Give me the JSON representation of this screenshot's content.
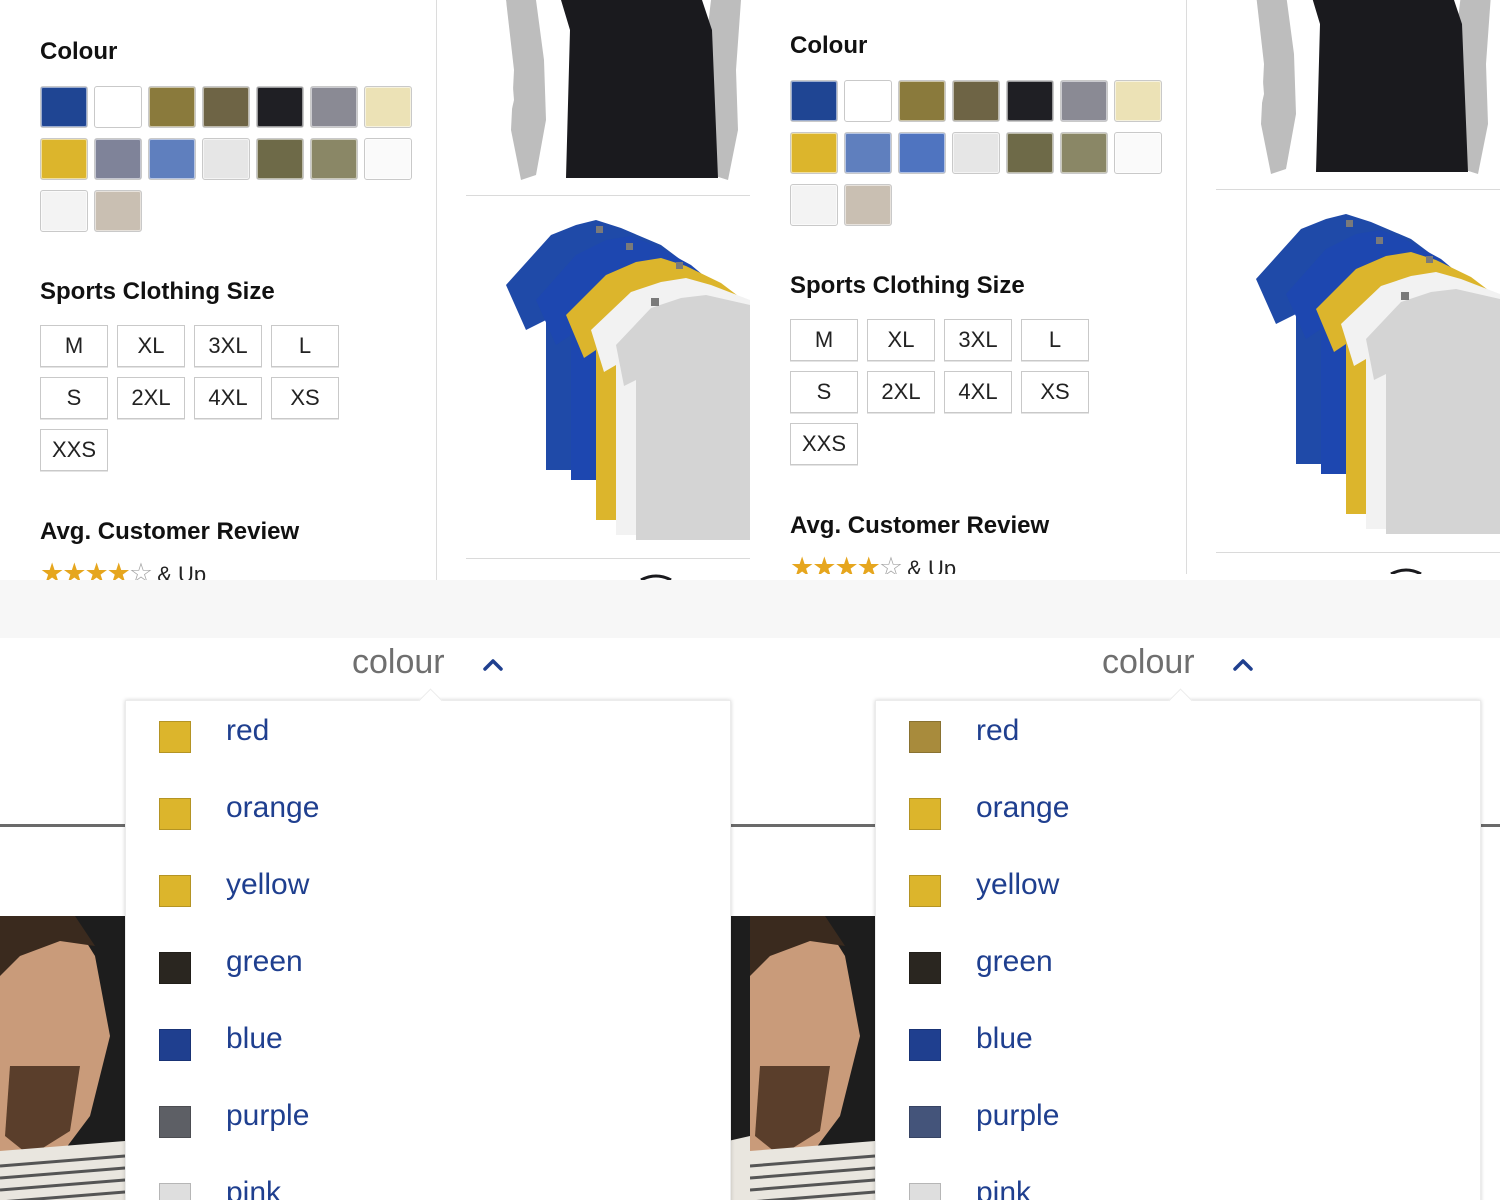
{
  "filters": {
    "colour_title": "Colour",
    "size_title": "Sports Clothing Size",
    "review_title": "Avg. Customer Review",
    "review_suffix": "& Up",
    "review_rating": 4,
    "review_max": 5,
    "sizes": [
      "M",
      "XL",
      "3XL",
      "L",
      "S",
      "2XL",
      "4XL",
      "XS",
      "XXS"
    ],
    "swatch_colors_left": [
      "#1f4593",
      "#ffffff",
      "#8a7a3c",
      "#6e6445",
      "#1f1f24",
      "#8a8a94",
      "#ece2b6",
      "#dcb52c",
      "#7f8399",
      "#5f7fbe",
      "#e6e6e6",
      "#6e6a48",
      "#8a8766",
      "#fafafa",
      "#f3f3f3",
      "#c9bfb2"
    ],
    "swatch_colors_right": [
      "#1f4593",
      "#ffffff",
      "#8a7a3c",
      "#6e6445",
      "#1f1f24",
      "#8a8a94",
      "#ece2b6",
      "#dcb52c",
      "#5f7fbe",
      "#4f74c0",
      "#e6e6e6",
      "#6e6a48",
      "#8a8766",
      "#fafafa",
      "#f3f3f3",
      "#c9bfb2"
    ]
  },
  "dropdown": {
    "label": "colour",
    "options_left": [
      {
        "name": "red",
        "color": "#dcb52c"
      },
      {
        "name": "orange",
        "color": "#dcb52c"
      },
      {
        "name": "yellow",
        "color": "#dcb52c"
      },
      {
        "name": "green",
        "color": "#2a2620"
      },
      {
        "name": "blue",
        "color": "#1f3f8f"
      },
      {
        "name": "purple",
        "color": "#5d5f65"
      },
      {
        "name": "pink",
        "color": "#dedede"
      }
    ],
    "options_right": [
      {
        "name": "red",
        "color": "#a88b3c"
      },
      {
        "name": "orange",
        "color": "#dcb52c"
      },
      {
        "name": "yellow",
        "color": "#dcb52c"
      },
      {
        "name": "green",
        "color": "#2a2620"
      },
      {
        "name": "blue",
        "color": "#1f3f8f"
      },
      {
        "name": "purple",
        "color": "#44547a"
      },
      {
        "name": "pink",
        "color": "#dedede"
      }
    ]
  },
  "colors": {
    "link_blue": "#1f3f8f",
    "star_gold": "#e6a61e",
    "tshirt_blue": "#1f4aa8",
    "tshirt_yellow": "#dcb52c",
    "tshirt_white": "#f2f2f2",
    "tshirt_grey": "#d4d4d4",
    "tshirt_black": "#1a1a1e"
  }
}
